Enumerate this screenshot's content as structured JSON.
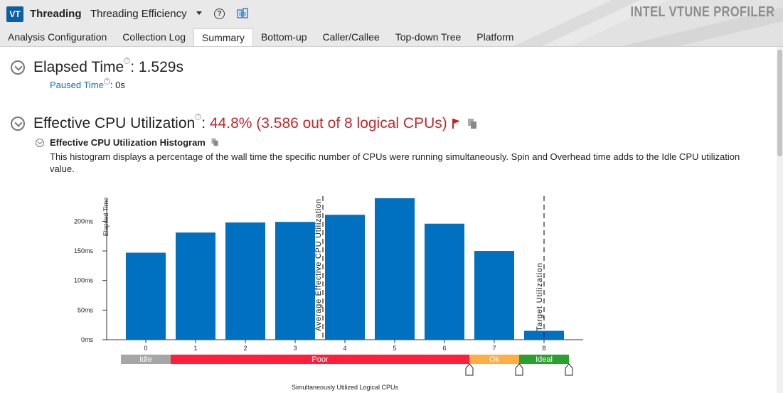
{
  "app": {
    "logo_text": "VT",
    "title": "Threading",
    "analysis_name": "Threading Efficiency",
    "brand": "INTEL VTUNE PROFILER",
    "help_icon_text": "?"
  },
  "tabs": [
    {
      "label": "Analysis Configuration",
      "active": false
    },
    {
      "label": "Collection Log",
      "active": false
    },
    {
      "label": "Summary",
      "active": true
    },
    {
      "label": "Bottom-up",
      "active": false
    },
    {
      "label": "Caller/Callee",
      "active": false
    },
    {
      "label": "Top-down Tree",
      "active": false
    },
    {
      "label": "Platform",
      "active": false
    }
  ],
  "elapsed": {
    "label": "Elapsed Time",
    "help_text": "?",
    "separator": ": ",
    "value": "1.529s",
    "paused_label": "Paused Time",
    "paused_separator": ": ",
    "paused_value": "0s"
  },
  "cpu_util": {
    "label": "Effective CPU Utilization",
    "help_text": "?",
    "separator": ": ",
    "value": "44.8% (3.586 out of 8 logical CPUs)",
    "value_color": "#c0282d"
  },
  "histogram": {
    "title": "Effective CPU Utilization Histogram",
    "description": "This histogram displays a percentage of the wall time the specific number of CPUs were running simultaneously. Spin and Overhead time adds to the Idle CPU utilization value."
  },
  "chart_data": {
    "type": "bar",
    "categories": [
      "0",
      "1",
      "2",
      "3",
      "4",
      "5",
      "6",
      "7",
      "8"
    ],
    "values": [
      147,
      181,
      198,
      199,
      211,
      239,
      196,
      150,
      15
    ],
    "ylabel": "Elapsed Time",
    "xlabel": "Simultaneously Utilized Logical CPUs",
    "ylim": [
      0,
      250
    ],
    "yticks": [
      0,
      50,
      100,
      150,
      200
    ],
    "ytick_labels": [
      "0ms",
      "50ms",
      "100ms",
      "150ms",
      "200ms"
    ],
    "bar_color": "#0070c0",
    "markers": [
      {
        "label": "Average Effective CPU Utilization",
        "x": 3.586
      },
      {
        "label": "Target Utilization",
        "x": 8
      }
    ],
    "zones": [
      {
        "label": "Idle",
        "from": -0.5,
        "to": 0.5,
        "color": "#a6a6a6"
      },
      {
        "label": "Poor",
        "from": 0.5,
        "to": 6.5,
        "color": "#ff1f3d"
      },
      {
        "label": "Ok",
        "from": 6.5,
        "to": 7.5,
        "color": "#ffae43"
      },
      {
        "label": "Ideal",
        "from": 7.5,
        "to": 8.5,
        "color": "#2aa12e"
      }
    ]
  }
}
